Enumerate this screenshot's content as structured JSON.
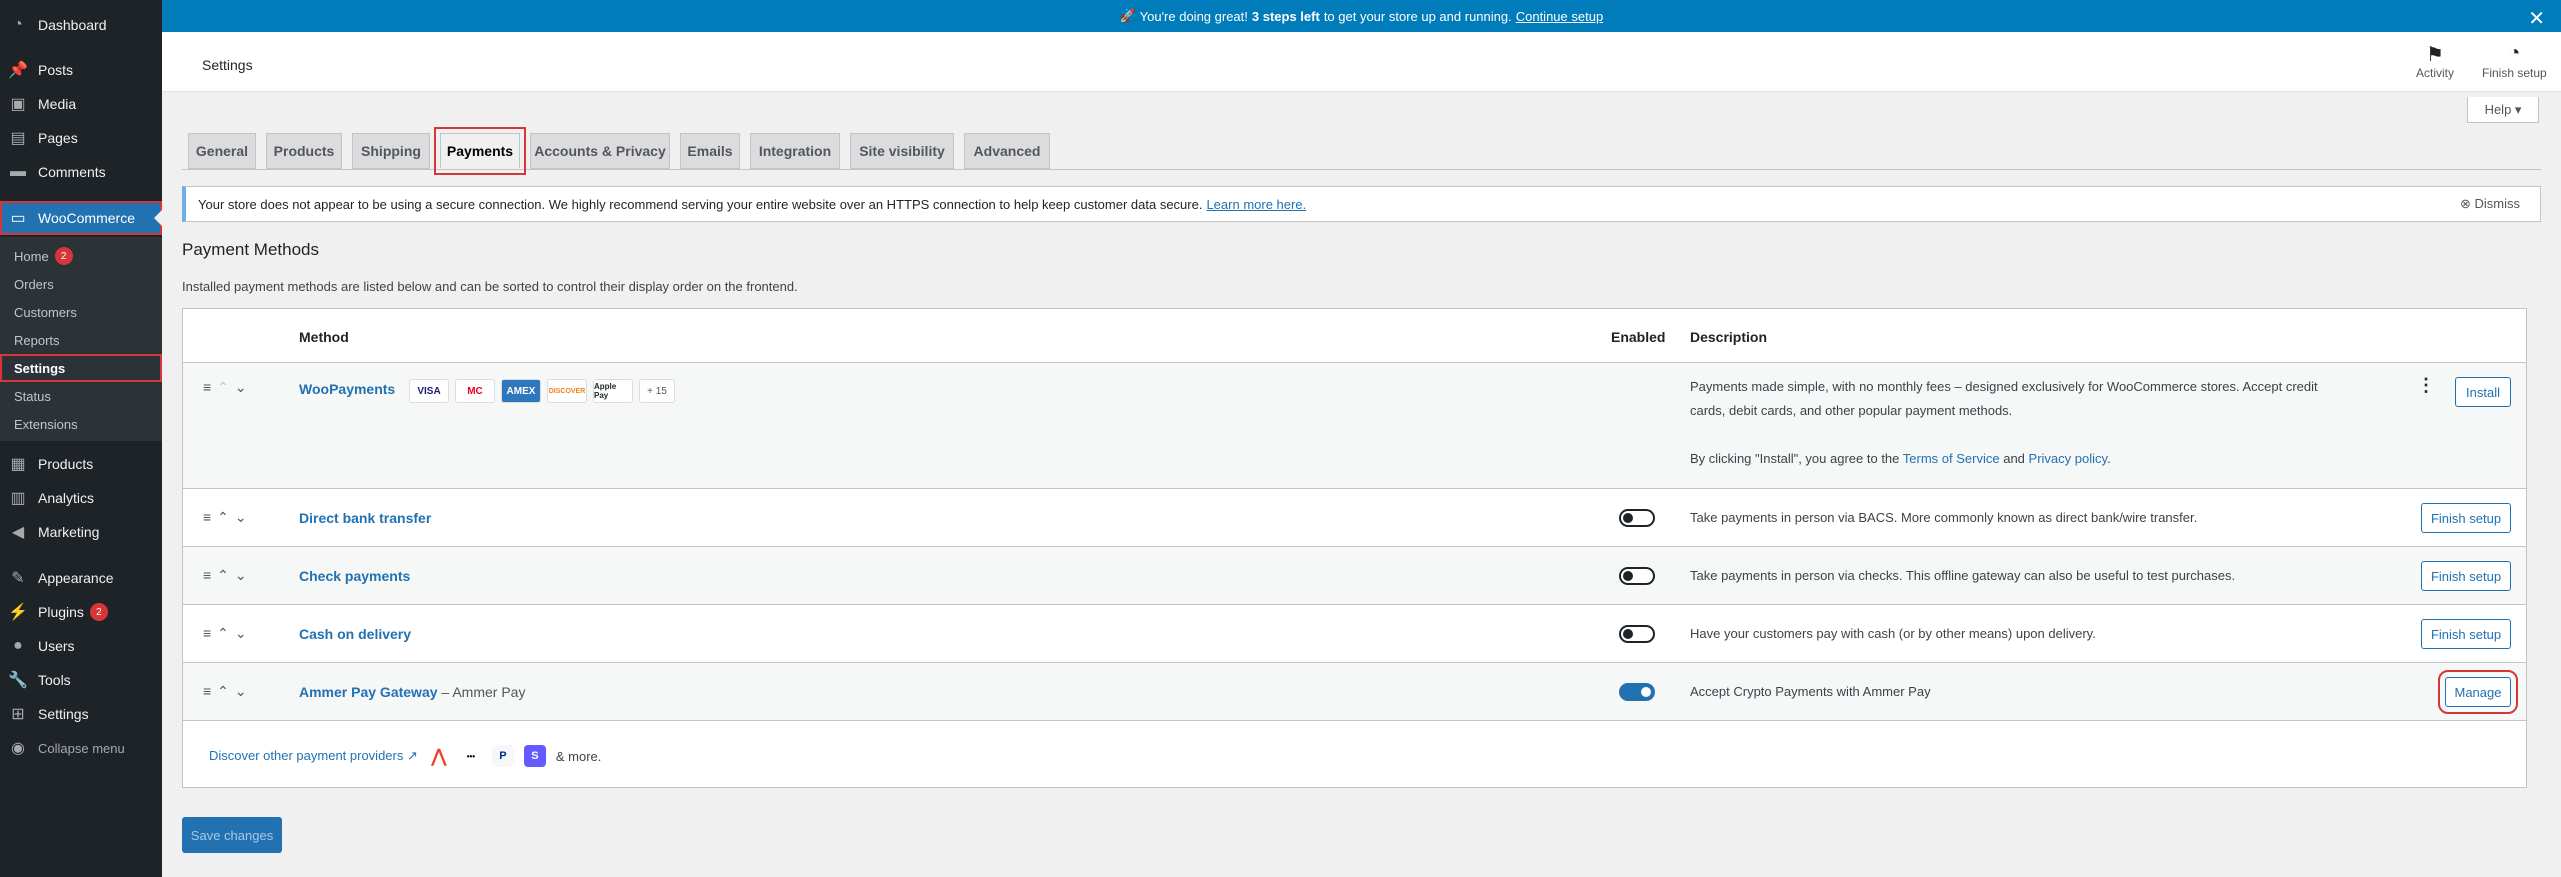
{
  "sidebar": {
    "items": [
      {
        "label": "Dashboard",
        "icon": "dashboard-icon"
      },
      {
        "label": "Posts",
        "icon": "pin-icon"
      },
      {
        "label": "Media",
        "icon": "media-icon"
      },
      {
        "label": "Pages",
        "icon": "page-icon"
      },
      {
        "label": "Comments",
        "icon": "comment-icon"
      },
      {
        "label": "WooCommerce",
        "icon": "woo-icon"
      },
      {
        "label": "Products",
        "icon": "archive-icon"
      },
      {
        "label": "Analytics",
        "icon": "chart-icon"
      },
      {
        "label": "Marketing",
        "icon": "megaphone-icon"
      },
      {
        "label": "Appearance",
        "icon": "brush-icon"
      },
      {
        "label": "Plugins",
        "icon": "plugin-icon",
        "badge": "2"
      },
      {
        "label": "Users",
        "icon": "user-icon"
      },
      {
        "label": "Tools",
        "icon": "wrench-icon"
      },
      {
        "label": "Settings",
        "icon": "settings-icon"
      },
      {
        "label": "Collapse menu",
        "icon": "collapse-icon"
      }
    ],
    "submenu": [
      {
        "label": "Home",
        "badge": "2"
      },
      {
        "label": "Orders"
      },
      {
        "label": "Customers"
      },
      {
        "label": "Reports"
      },
      {
        "label": "Settings"
      },
      {
        "label": "Status"
      },
      {
        "label": "Extensions"
      }
    ]
  },
  "banner": {
    "emoji": "🚀",
    "text_before": "You're doing great!",
    "bold": "3 steps left",
    "text_after": "to get your store up and running.",
    "link": "Continue setup"
  },
  "header": {
    "title": "Settings",
    "activity": "Activity",
    "finish_setup": "Finish setup",
    "help": "Help ▾"
  },
  "tabs": [
    "General",
    "Products",
    "Shipping",
    "Payments",
    "Accounts & Privacy",
    "Emails",
    "Integration",
    "Site visibility",
    "Advanced"
  ],
  "notice": {
    "text": "Your store does not appear to be using a secure connection. We highly recommend serving your entire website over an HTTPS connection to help keep customer data secure.",
    "link": "Learn more here.",
    "dismiss": "Dismiss"
  },
  "payment_methods": {
    "title": "Payment Methods",
    "description": "Installed payment methods are listed below and can be sorted to control their display order on the frontend.",
    "columns": {
      "method": "Method",
      "enabled": "Enabled",
      "description": "Description"
    },
    "woopayments": {
      "name": "WooPayments",
      "cards": [
        "VISA",
        "MC",
        "AMEX",
        "DISCOVER",
        "Apple Pay",
        "+ 15"
      ],
      "desc1": "Payments made simple, with no monthly fees – designed exclusively for WooCommerce stores. Accept credit",
      "desc2": "cards, debit cards, and other popular payment methods.",
      "agree_before": "By clicking \"Install\", you agree to the",
      "tos": "Terms of Service",
      "and": "and",
      "privacy": "Privacy policy",
      "button": "Install"
    },
    "rows": [
      {
        "name": "Direct bank transfer",
        "sub": "",
        "enabled": false,
        "desc": "Take payments in person via BACS. More commonly known as direct bank/wire transfer.",
        "button": "Finish setup"
      },
      {
        "name": "Check payments",
        "sub": "",
        "enabled": false,
        "desc": "Take payments in person via checks. This offline gateway can also be useful to test purchases.",
        "button": "Finish setup"
      },
      {
        "name": "Cash on delivery",
        "sub": "",
        "enabled": false,
        "desc": "Have your customers pay with cash (or by other means) upon delivery.",
        "button": "Finish setup"
      },
      {
        "name": "Ammer Pay Gateway",
        "sub": "– Ammer Pay",
        "enabled": true,
        "desc": "Accept Crypto Payments with Ammer Pay",
        "button": "Manage"
      }
    ],
    "discover": "Discover other payment providers",
    "more": "& more."
  },
  "save_button": "Save changes"
}
